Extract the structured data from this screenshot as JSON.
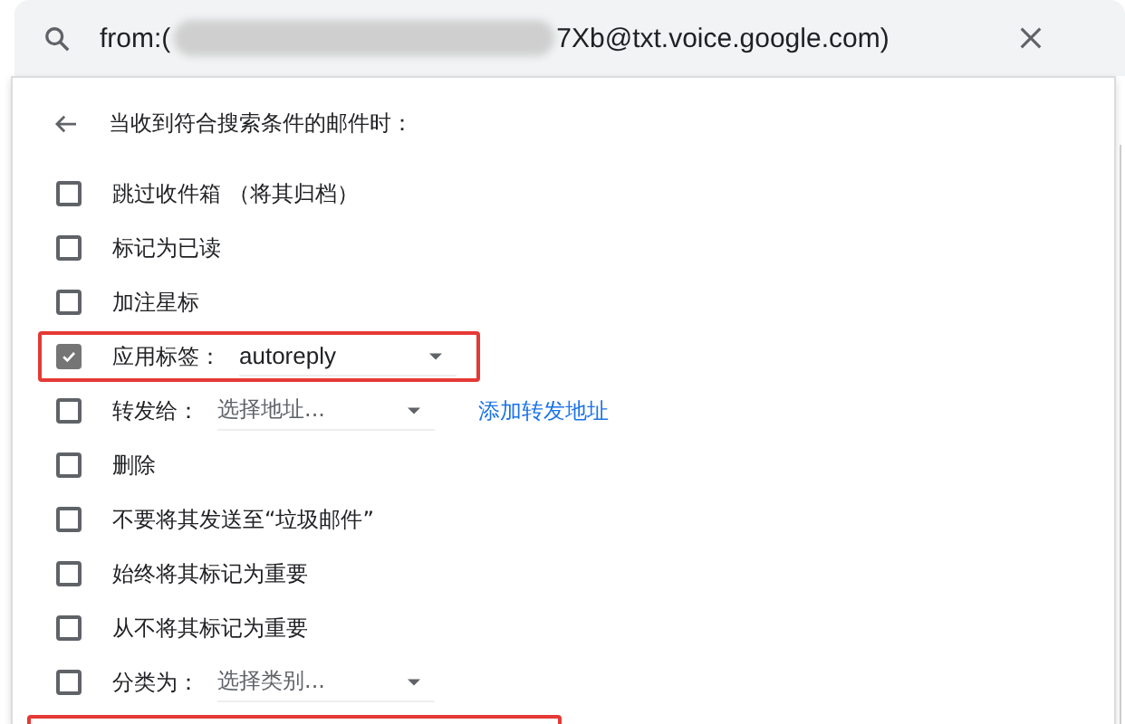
{
  "search": {
    "query_start": "from:(",
    "redacted": true,
    "query_end": "7Xb@txt.voice.google.com)"
  },
  "panel": {
    "heading": "当收到符合搜索条件的邮件时：",
    "options": [
      {
        "kind": "check",
        "label": "跳过收件箱 （将其归档）",
        "checked": false,
        "highlighted": false
      },
      {
        "kind": "check",
        "label": "标记为已读",
        "checked": false,
        "highlighted": false
      },
      {
        "kind": "check",
        "label": "加注星标",
        "checked": false,
        "highlighted": false
      },
      {
        "kind": "select",
        "label": "应用标签：",
        "value": "autoreply",
        "value_set": true,
        "checked": true,
        "highlighted": true
      },
      {
        "kind": "select",
        "label": "转发给：",
        "value": "选择地址...",
        "value_set": false,
        "link": "添加转发地址",
        "checked": false,
        "highlighted": false
      },
      {
        "kind": "check",
        "label": "删除",
        "checked": false,
        "highlighted": false
      },
      {
        "kind": "check",
        "label": "不要将其发送至“垃圾邮件”",
        "checked": false,
        "highlighted": false
      },
      {
        "kind": "check",
        "label": "始终将其标记为重要",
        "checked": false,
        "highlighted": false
      },
      {
        "kind": "check",
        "label": "从不将其标记为重要",
        "checked": false,
        "highlighted": false
      },
      {
        "kind": "select",
        "label": "分类为：",
        "value": "选择类别...",
        "value_set": false,
        "checked": false,
        "highlighted": false
      }
    ],
    "lower_highlight": true
  }
}
